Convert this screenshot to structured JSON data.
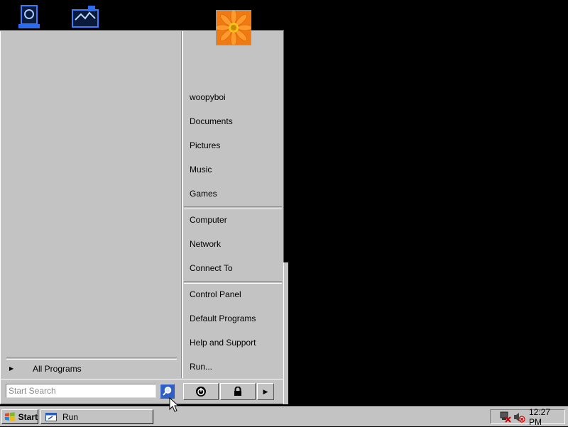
{
  "colors": {
    "desktop": "#000000",
    "menu_face": "#c3c3c3",
    "accent": "#2f5fc4",
    "flower": "#f07a12"
  },
  "desktop": {
    "icons": [
      {
        "name": "recycle-bin-icon"
      },
      {
        "name": "network-icon"
      }
    ]
  },
  "start_menu": {
    "user_picture_icon": "flower-user-picture",
    "right_items": {
      "user": "woopyboi",
      "documents": "Documents",
      "pictures": "Pictures",
      "music": "Music",
      "games": "Games",
      "computer": "Computer",
      "network": "Network",
      "connect_to": "Connect To",
      "control_panel": "Control Panel",
      "default_programs": "Default Programs",
      "help_and_support": "Help and Support",
      "run": "Run..."
    },
    "all_programs": "All Programs",
    "search": {
      "placeholder": "Start Search",
      "value": ""
    },
    "buttons": {
      "power_icon": "power-icon",
      "lock_icon": "lock-icon",
      "arrow_icon": "arrow-right-icon"
    }
  },
  "taskbar": {
    "start_label": "Start",
    "task_run_label": "Run",
    "clock": "12:27 PM",
    "tray_icons": [
      "network-disconnected-icon",
      "volume-muted-icon"
    ]
  }
}
